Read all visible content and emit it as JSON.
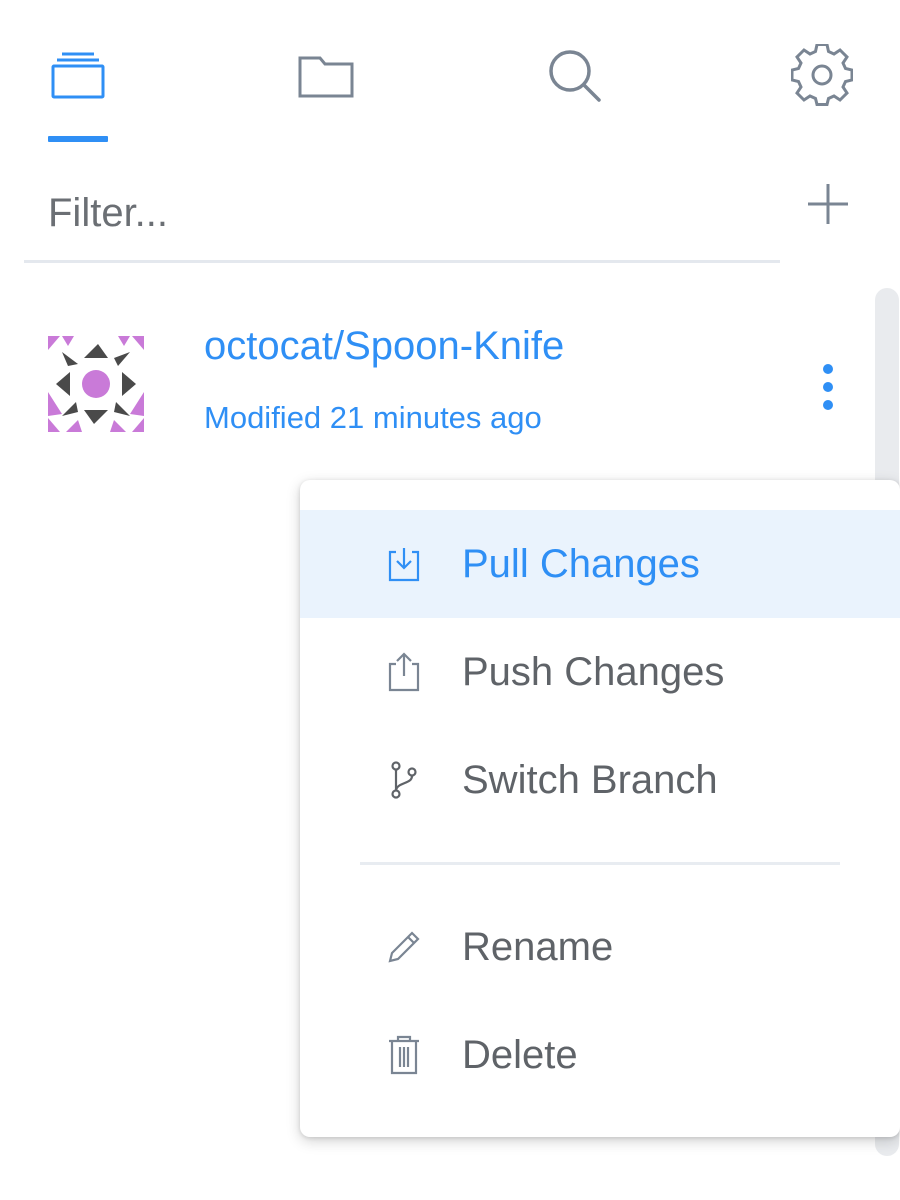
{
  "tabs": [
    {
      "icon": "repositories-icon",
      "active": true
    },
    {
      "icon": "folder-icon",
      "active": false
    },
    {
      "icon": "search-icon",
      "active": false
    },
    {
      "icon": "gear-icon",
      "active": false
    }
  ],
  "filter": {
    "placeholder": "Filter...",
    "value": ""
  },
  "repositories": [
    {
      "name": "octocat/Spoon-Knife",
      "meta": "Modified 21 minutes ago"
    }
  ],
  "context_menu": {
    "items": [
      {
        "label": "Pull Changes",
        "icon": "pull-icon",
        "highlighted": true
      },
      {
        "label": "Push Changes",
        "icon": "push-icon",
        "highlighted": false
      },
      {
        "label": "Switch Branch",
        "icon": "branch-icon",
        "highlighted": false
      }
    ],
    "secondary_items": [
      {
        "label": "Rename",
        "icon": "pencil-icon"
      },
      {
        "label": "Delete",
        "icon": "trash-icon"
      }
    ]
  },
  "colors": {
    "accent": "#2f8ff5",
    "icon": "#7a8593",
    "text": "#5f6368",
    "highlight": "#eaf3fd",
    "avatar_pink": "#c97ad8",
    "avatar_dark": "#4a4a4a"
  }
}
